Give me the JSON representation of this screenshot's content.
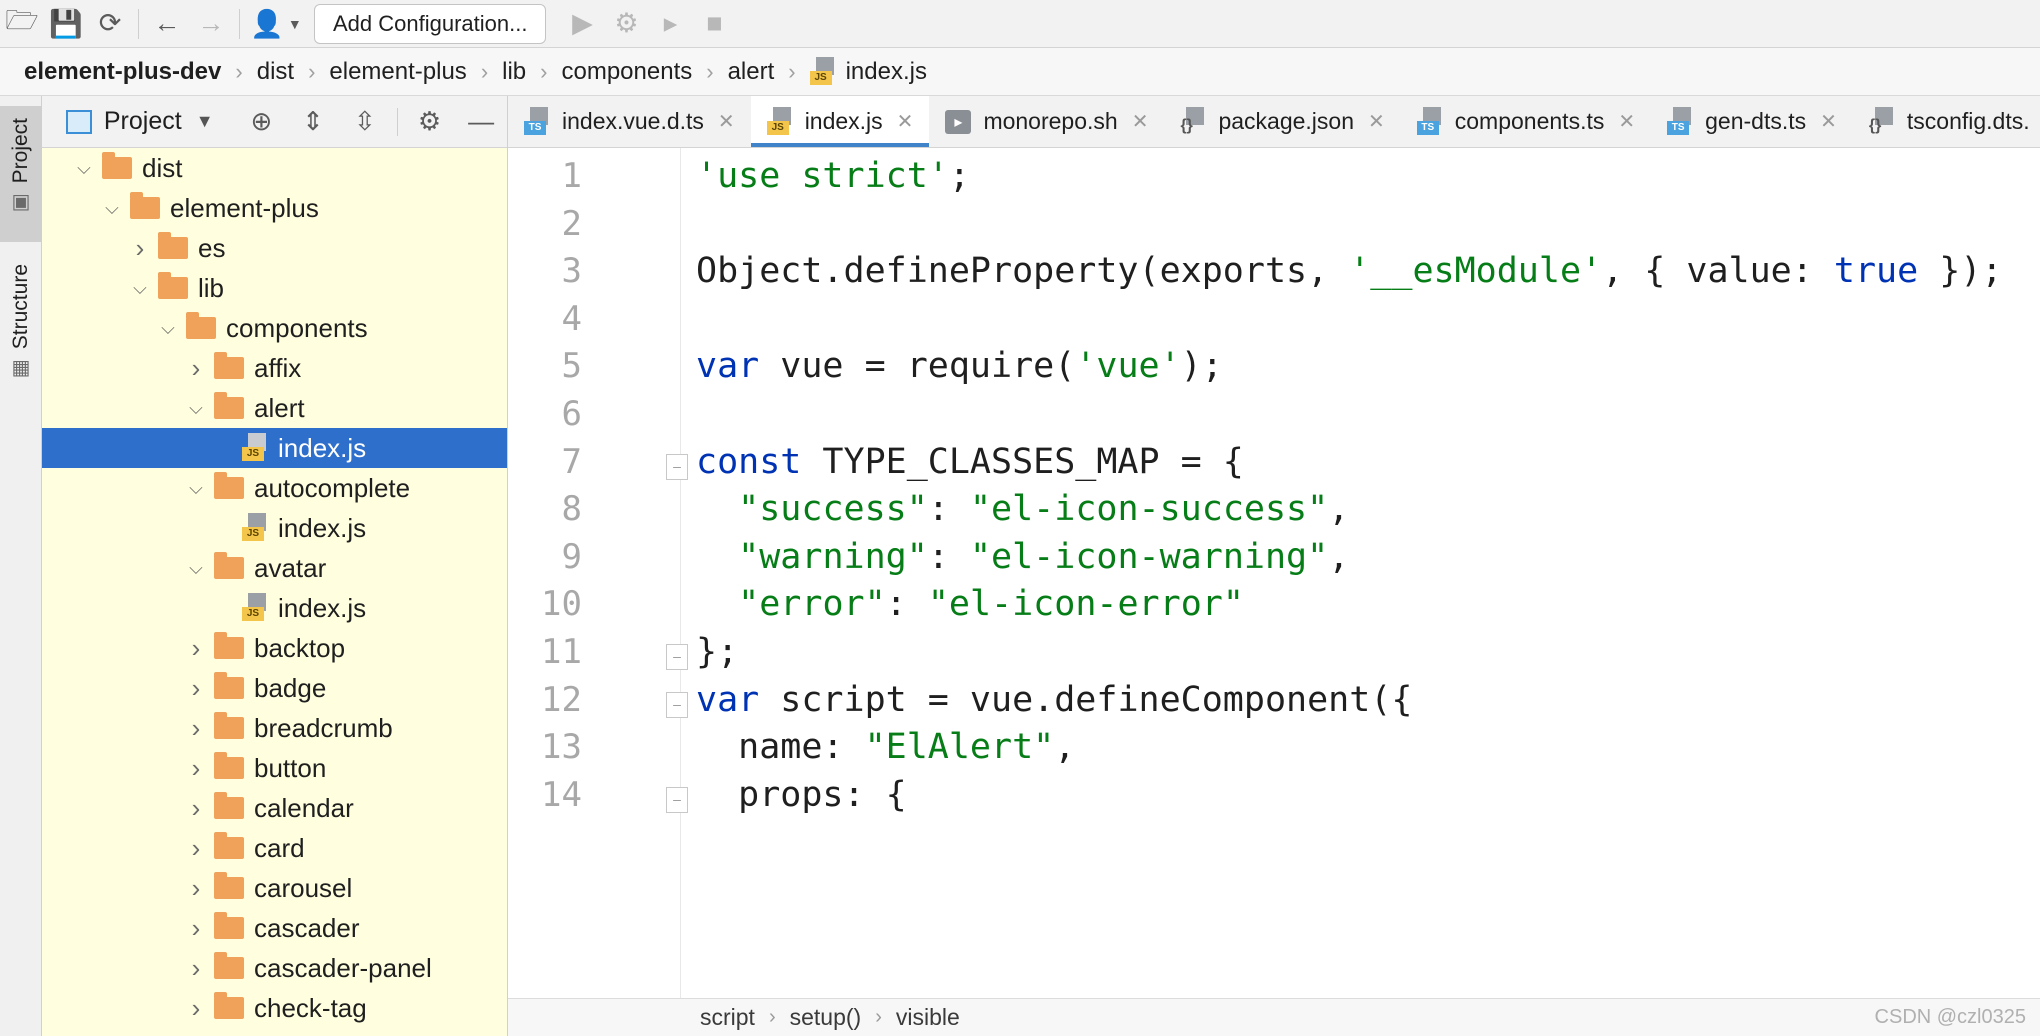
{
  "toolbar": {
    "icons": [
      "open-folder-icon",
      "save-icon",
      "sync-icon",
      "back-icon",
      "forward-icon",
      "user-icon",
      "run-icon",
      "debug-icon",
      "coverage-icon",
      "stop-icon"
    ],
    "add_configuration": "Add Configuration..."
  },
  "breadcrumb": [
    "element-plus-dev",
    "dist",
    "element-plus",
    "lib",
    "components",
    "alert",
    "index.js"
  ],
  "tool_strip": {
    "project": "Project",
    "structure": "Structure"
  },
  "project_panel": {
    "title": "Project",
    "tree": [
      {
        "label": "dist",
        "type": "folder",
        "level": 1,
        "expanded": true
      },
      {
        "label": "element-plus",
        "type": "folder",
        "level": 2,
        "expanded": true
      },
      {
        "label": "es",
        "type": "folder",
        "level": 3,
        "expanded": false
      },
      {
        "label": "lib",
        "type": "folder",
        "level": 3,
        "expanded": true
      },
      {
        "label": "components",
        "type": "folder",
        "level": 4,
        "expanded": true
      },
      {
        "label": "affix",
        "type": "folder",
        "level": 5,
        "expanded": false
      },
      {
        "label": "alert",
        "type": "folder",
        "level": 5,
        "expanded": true
      },
      {
        "label": "index.js",
        "type": "js",
        "level": 6,
        "selected": true
      },
      {
        "label": "autocomplete",
        "type": "folder",
        "level": 5,
        "expanded": true
      },
      {
        "label": "index.js",
        "type": "js",
        "level": 6
      },
      {
        "label": "avatar",
        "type": "folder",
        "level": 5,
        "expanded": true
      },
      {
        "label": "index.js",
        "type": "js",
        "level": 6
      },
      {
        "label": "backtop",
        "type": "folder",
        "level": 5,
        "expanded": false
      },
      {
        "label": "badge",
        "type": "folder",
        "level": 5,
        "expanded": false
      },
      {
        "label": "breadcrumb",
        "type": "folder",
        "level": 5,
        "expanded": false
      },
      {
        "label": "button",
        "type": "folder",
        "level": 5,
        "expanded": false
      },
      {
        "label": "calendar",
        "type": "folder",
        "level": 5,
        "expanded": false
      },
      {
        "label": "card",
        "type": "folder",
        "level": 5,
        "expanded": false
      },
      {
        "label": "carousel",
        "type": "folder",
        "level": 5,
        "expanded": false
      },
      {
        "label": "cascader",
        "type": "folder",
        "level": 5,
        "expanded": false
      },
      {
        "label": "cascader-panel",
        "type": "folder",
        "level": 5,
        "expanded": false
      },
      {
        "label": "check-tag",
        "type": "folder",
        "level": 5,
        "expanded": false
      }
    ]
  },
  "tabs": [
    {
      "label": "index.vue.d.ts",
      "icon": "ts",
      "active": false
    },
    {
      "label": "index.js",
      "icon": "js",
      "active": true
    },
    {
      "label": "monorepo.sh",
      "icon": "sh",
      "active": false
    },
    {
      "label": "package.json",
      "icon": "json",
      "active": false
    },
    {
      "label": "components.ts",
      "icon": "ts",
      "active": false
    },
    {
      "label": "gen-dts.ts",
      "icon": "ts",
      "active": false
    },
    {
      "label": "tsconfig.dts.",
      "icon": "json",
      "active": false
    }
  ],
  "code": [
    {
      "n": "1",
      "tokens": [
        [
          "str",
          "'use strict'"
        ],
        [
          "",
          ";"
        ]
      ]
    },
    {
      "n": "2",
      "tokens": []
    },
    {
      "n": "3",
      "tokens": [
        [
          "",
          "Object.defineProperty(exports, "
        ],
        [
          "str",
          "'__esModule'"
        ],
        [
          "",
          ", { value: "
        ],
        [
          "kw",
          "true"
        ],
        [
          "",
          " });"
        ]
      ]
    },
    {
      "n": "4",
      "tokens": []
    },
    {
      "n": "5",
      "tokens": [
        [
          "kw",
          "var"
        ],
        [
          "",
          " vue = require("
        ],
        [
          "str",
          "'vue'"
        ],
        [
          "",
          ");"
        ]
      ]
    },
    {
      "n": "6",
      "tokens": []
    },
    {
      "n": "7",
      "tokens": [
        [
          "kw",
          "const"
        ],
        [
          "",
          " TYPE_CLASSES_MAP = {"
        ]
      ],
      "fold": "open"
    },
    {
      "n": "8",
      "tokens": [
        [
          "",
          "  "
        ],
        [
          "str",
          "\"success\""
        ],
        [
          "",
          ": "
        ],
        [
          "str",
          "\"el-icon-success\""
        ],
        [
          "",
          ","
        ]
      ]
    },
    {
      "n": "9",
      "tokens": [
        [
          "",
          "  "
        ],
        [
          "str",
          "\"warning\""
        ],
        [
          "",
          ": "
        ],
        [
          "str",
          "\"el-icon-warning\""
        ],
        [
          "",
          ","
        ]
      ]
    },
    {
      "n": "10",
      "tokens": [
        [
          "",
          "  "
        ],
        [
          "str",
          "\"error\""
        ],
        [
          "",
          ": "
        ],
        [
          "str",
          "\"el-icon-error\""
        ]
      ]
    },
    {
      "n": "11",
      "tokens": [
        [
          "",
          "};"
        ]
      ],
      "fold": "close"
    },
    {
      "n": "12",
      "tokens": [
        [
          "kw",
          "var"
        ],
        [
          "",
          " script = vue.defineComponent({"
        ]
      ],
      "fold": "open"
    },
    {
      "n": "13",
      "tokens": [
        [
          "",
          "  name: "
        ],
        [
          "str",
          "\"ElAlert\""
        ],
        [
          "",
          ","
        ]
      ]
    },
    {
      "n": "14",
      "tokens": [
        [
          "",
          "  props: {"
        ]
      ],
      "fold": "open"
    }
  ],
  "status_breadcrumb": [
    "script",
    "setup()",
    "visible"
  ],
  "watermark": "CSDN @czl0325"
}
